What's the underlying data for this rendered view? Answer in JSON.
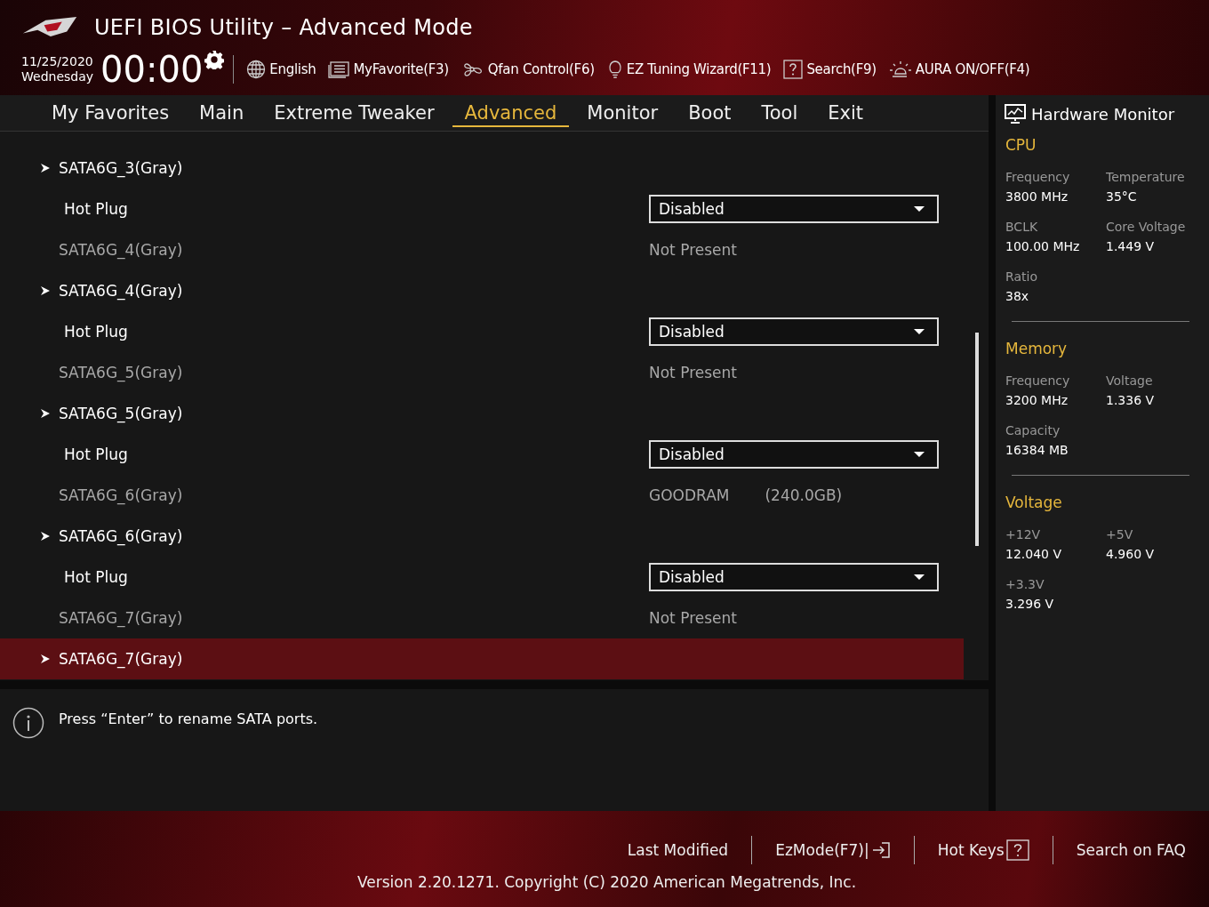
{
  "window": {
    "title": "UEFI BIOS Utility – Advanced Mode"
  },
  "header": {
    "date": "11/25/2020",
    "day": "Wednesday",
    "time": "00:00",
    "tools": [
      {
        "kind": "globe",
        "label": "English"
      },
      {
        "kind": "list",
        "label": "MyFavorite(F3)"
      },
      {
        "kind": "fan",
        "label": "Qfan Control(F6)"
      },
      {
        "kind": "bulb",
        "label": "EZ Tuning Wizard(F11)"
      },
      {
        "kind": "help",
        "label": "Search(F9)"
      },
      {
        "kind": "aura",
        "label": "AURA ON/OFF(F4)"
      }
    ]
  },
  "tabs": [
    {
      "label": "My Favorites",
      "selected": false
    },
    {
      "label": "Main",
      "selected": false
    },
    {
      "label": "Extreme Tweaker",
      "selected": false
    },
    {
      "label": "Advanced",
      "selected": true
    },
    {
      "label": "Monitor",
      "selected": false
    },
    {
      "label": "Boot",
      "selected": false
    },
    {
      "label": "Tool",
      "selected": false
    },
    {
      "label": "Exit",
      "selected": false
    }
  ],
  "settings": [
    {
      "kind": "submenu",
      "label": "SATA6G_3(Gray)",
      "selected": false
    },
    {
      "kind": "dropdown",
      "label": "Hot Plug",
      "value": "Disabled"
    },
    {
      "kind": "info",
      "label": "SATA6G_4(Gray)",
      "values": [
        "Not Present"
      ]
    },
    {
      "kind": "submenu",
      "label": "SATA6G_4(Gray)",
      "selected": false
    },
    {
      "kind": "dropdown",
      "label": "Hot Plug",
      "value": "Disabled"
    },
    {
      "kind": "info",
      "label": "SATA6G_5(Gray)",
      "values": [
        "Not Present"
      ]
    },
    {
      "kind": "submenu",
      "label": "SATA6G_5(Gray)",
      "selected": false
    },
    {
      "kind": "dropdown",
      "label": "Hot Plug",
      "value": "Disabled"
    },
    {
      "kind": "info",
      "label": "SATA6G_6(Gray)",
      "values": [
        "GOODRAM",
        "(240.0GB)"
      ]
    },
    {
      "kind": "submenu",
      "label": "SATA6G_6(Gray)",
      "selected": false
    },
    {
      "kind": "dropdown",
      "label": "Hot Plug",
      "value": "Disabled"
    },
    {
      "kind": "info",
      "label": "SATA6G_7(Gray)",
      "values": [
        "Not Present"
      ]
    },
    {
      "kind": "submenu",
      "label": "SATA6G_7(Gray)",
      "selected": true
    }
  ],
  "help_text": "Press “Enter” to rename SATA ports.",
  "hardware_monitor": {
    "title": "Hardware Monitor",
    "sections": [
      {
        "title": "CPU",
        "items": [
          {
            "label": "Frequency",
            "value": "3800 MHz"
          },
          {
            "label": "Temperature",
            "value": "35°C"
          },
          {
            "label": "BCLK",
            "value": "100.00 MHz"
          },
          {
            "label": "Core Voltage",
            "value": "1.449 V"
          },
          {
            "label": "Ratio",
            "value": "38x"
          }
        ]
      },
      {
        "title": "Memory",
        "items": [
          {
            "label": "Frequency",
            "value": "3200 MHz"
          },
          {
            "label": "Voltage",
            "value": "1.336 V"
          },
          {
            "label": "Capacity",
            "value": "16384 MB"
          }
        ]
      },
      {
        "title": "Voltage",
        "items": [
          {
            "label": "+12V",
            "value": "12.040 V"
          },
          {
            "label": "+5V",
            "value": "4.960 V"
          },
          {
            "label": "+3.3V",
            "value": "3.296 V"
          }
        ]
      }
    ]
  },
  "footer": {
    "links": [
      {
        "kind": "text",
        "label": "Last Modified"
      },
      {
        "kind": "exit",
        "label": "EzMode(F7)|"
      },
      {
        "kind": "help",
        "label": "Hot Keys"
      },
      {
        "kind": "text",
        "label": "Search on FAQ"
      }
    ],
    "version": "Version 2.20.1271. Copyright (C) 2020 American Megatrends, Inc."
  }
}
